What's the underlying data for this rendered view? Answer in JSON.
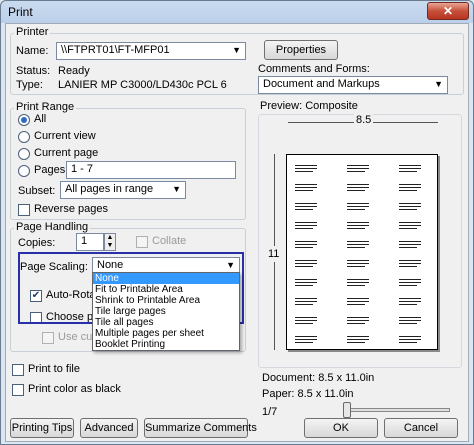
{
  "window": {
    "title": "Print",
    "close_glyph": "✕"
  },
  "printer": {
    "group_label": "Printer",
    "name_label": "Name:",
    "name_value": "\\\\FTPRT01\\FT-MFP01",
    "properties_button": "Properties",
    "status_label": "Status:",
    "status_value": "Ready",
    "type_label": "Type:",
    "type_value": "LANIER MP C3000/LD430c PCL 6"
  },
  "comments_forms": {
    "label": "Comments and Forms:",
    "value": "Document and Markups"
  },
  "print_range": {
    "group_label": "Print Range",
    "all": "All",
    "current_view": "Current view",
    "current_page": "Current page",
    "pages": "Pages",
    "pages_value": "1 - 7",
    "subset_label": "Subset:",
    "subset_value": "All pages in range",
    "reverse_pages": "Reverse pages"
  },
  "page_handling": {
    "group_label": "Page Handling",
    "copies_label": "Copies:",
    "copies_value": "1",
    "collate": "Collate",
    "page_scaling_label": "Page Scaling:",
    "page_scaling_value": "None",
    "auto_rotate": "Auto-Rotate",
    "choose_paper": "Choose pape",
    "use_custom": "Use custo",
    "scaling_options": [
      "None",
      "Fit to Printable Area",
      "Shrink to Printable Area",
      "Tile large pages",
      "Tile all pages",
      "Multiple pages per sheet",
      "Booklet Printing"
    ]
  },
  "options": {
    "print_to_file": "Print to file",
    "print_color_as_black": "Print color as black"
  },
  "preview": {
    "label": "Preview: Composite",
    "width_label": "8.5",
    "height_label": "11",
    "document_size": "Document: 8.5 x 11.0in",
    "paper_size": "Paper: 8.5 x 11.0in",
    "page_indicator": "1/7",
    "page_fraction": 0.14
  },
  "buttons": {
    "printing_tips": "Printing Tips",
    "advanced": "Advanced",
    "summarize_comments": "Summarize Comments",
    "ok": "OK",
    "cancel": "Cancel"
  }
}
